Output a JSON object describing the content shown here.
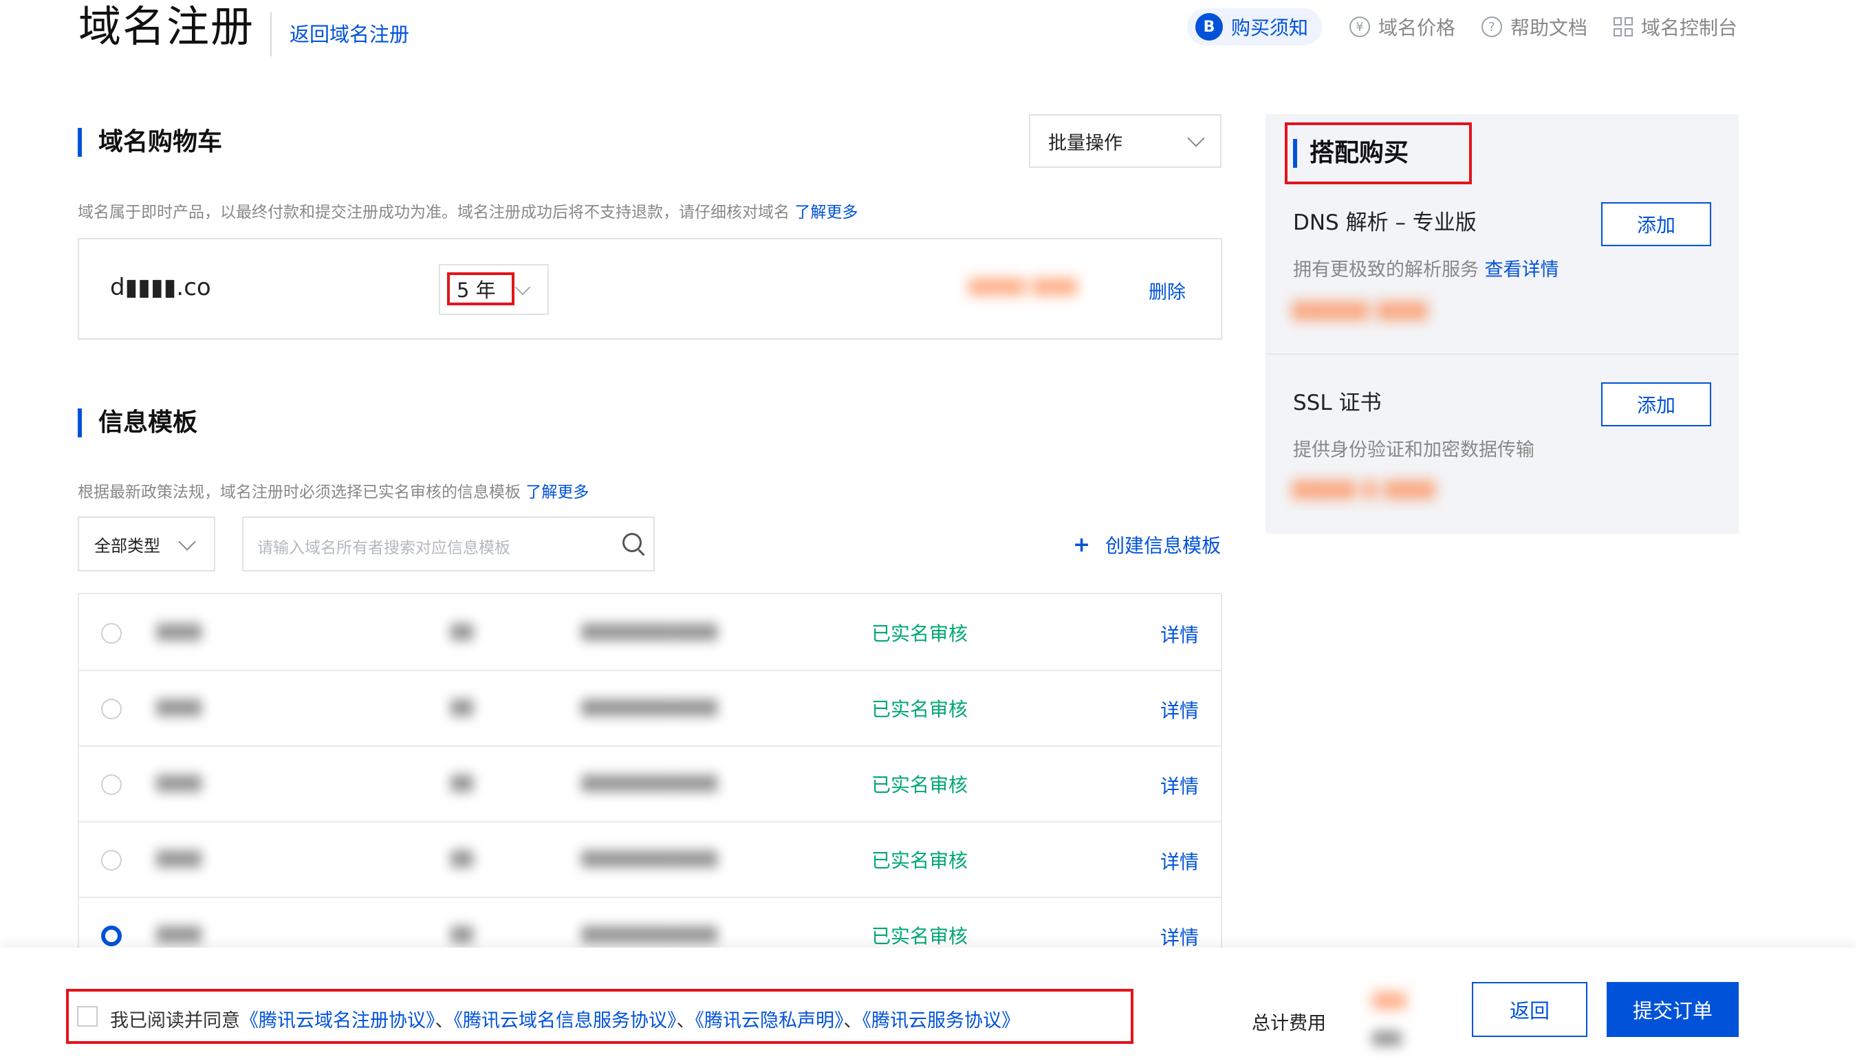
{
  "header": {
    "title": "域名注册",
    "back_link": "返回域名注册",
    "nav": [
      {
        "label": "购买须知",
        "icon": "B"
      },
      {
        "label": "域名价格",
        "icon": "¥"
      },
      {
        "label": "帮助文档",
        "icon": "?"
      },
      {
        "label": "域名控制台",
        "icon": "grid"
      }
    ]
  },
  "cart": {
    "title": "域名购物车",
    "batch_label": "批量操作",
    "notice": "域名属于即时产品，以最终付款和提交注册成功为准。域名注册成功后将不支持退款，请仔细核对域名",
    "learn_more": "了解更多",
    "item": {
      "domain": "d▮▮▮▮.co",
      "years": "5 年",
      "price_blurred": "▮▮▮▮▮ ▮▮▮▮",
      "delete": "删除"
    }
  },
  "template": {
    "title": "信息模板",
    "notice": "根据最新政策法规，域名注册时必须选择已实名审核的信息模板",
    "learn_more": "了解更多",
    "type_select": "全部类型",
    "search_placeholder": "请输入域名所有者搜索对应信息模板",
    "create_label": "创建信息模板",
    "rows": [
      {
        "name": "▮▮▮▮",
        "type": "▮▮",
        "email": "▮▮▮▮▮▮▮▮▮▮▮▮",
        "status": "已实名审核",
        "detail": "详情",
        "selected": false
      },
      {
        "name": "▮▮▮▮",
        "type": "▮▮",
        "email": "▮▮▮▮▮▮▮▮▮▮▮▮",
        "status": "已实名审核",
        "detail": "详情",
        "selected": false
      },
      {
        "name": "▮▮▮▮",
        "type": "▮▮",
        "email": "▮▮▮▮▮▮▮▮▮▮▮▮",
        "status": "已实名审核",
        "detail": "详情",
        "selected": false
      },
      {
        "name": "▮▮▮▮",
        "type": "▮▮",
        "email": "▮▮▮▮▮▮▮▮▮▮▮▮",
        "status": "已实名审核",
        "detail": "详情",
        "selected": false
      },
      {
        "name": "▮▮▮▮",
        "type": "▮▮",
        "email": "▮▮▮▮▮▮▮▮▮▮▮▮",
        "status": "已实名审核",
        "detail": "详情",
        "selected": true
      }
    ]
  },
  "side": {
    "title": "搭配购买",
    "products": [
      {
        "name": "DNS 解析 – 专业版",
        "desc": "拥有更极致的解析服务",
        "desc_link": "查看详情",
        "add": "添加",
        "price_blurred": "▮▮▮▮▮▮ ▮▮▮▮"
      },
      {
        "name": "SSL  证书",
        "desc": "提供身份验证和加密数据传输",
        "desc_link": "",
        "add": "添加",
        "price_blurred": "▮▮▮▮▮ ▮ ▮▮▮▮"
      }
    ]
  },
  "footer": {
    "agree_prefix": "我已阅读并同意",
    "agreements": [
      "《腾讯云域名注册协议》",
      "《腾讯云域名信息服务协议》",
      "《腾讯云隐私声明》",
      "《腾讯云服务协议》"
    ],
    "total_label": "总计费用",
    "total_value": "▮▮▮",
    "total_sub": "▮▮▮",
    "return_btn": "返回",
    "submit_btn": "提交订单"
  },
  "colors": {
    "accent": "#0052d9",
    "success": "#00a870",
    "highlight": "#e3141c"
  }
}
